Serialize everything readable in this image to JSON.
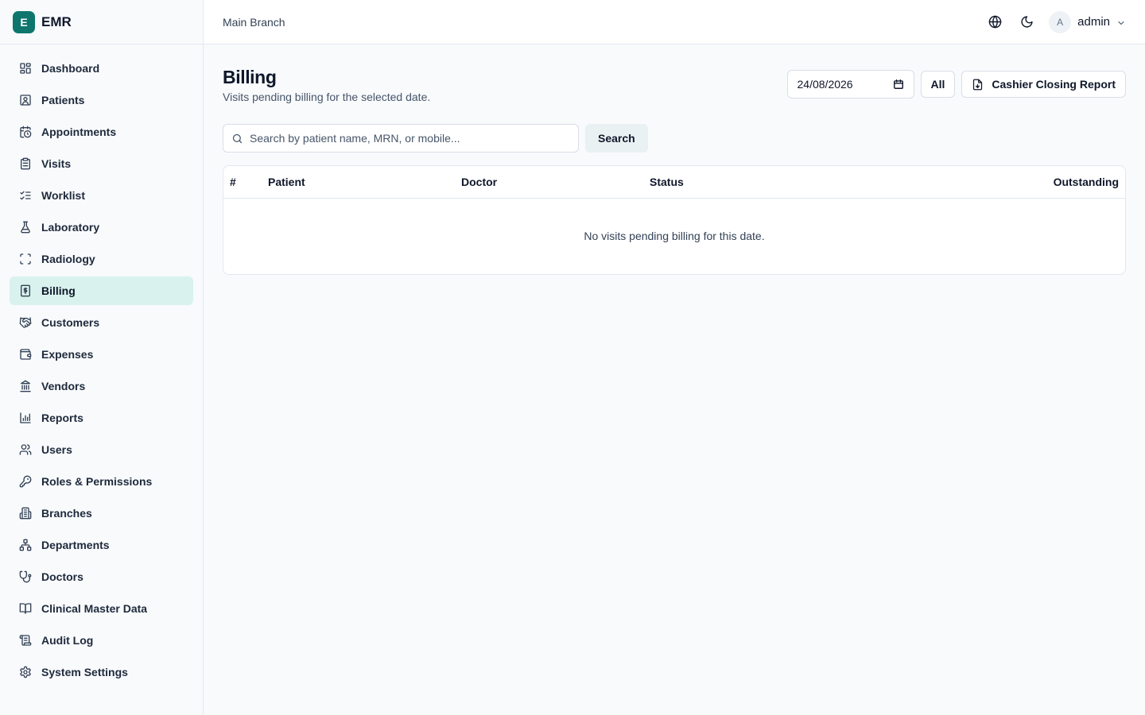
{
  "brand": {
    "logo_letter": "E",
    "name": "EMR"
  },
  "sidebar": {
    "items": [
      {
        "label": "Dashboard",
        "icon": "dashboard-icon",
        "active": false
      },
      {
        "label": "Patients",
        "icon": "patient-icon",
        "active": false
      },
      {
        "label": "Appointments",
        "icon": "calendar-clock-icon",
        "active": false
      },
      {
        "label": "Visits",
        "icon": "clipboard-icon",
        "active": false
      },
      {
        "label": "Worklist",
        "icon": "list-checks-icon",
        "active": false
      },
      {
        "label": "Laboratory",
        "icon": "flask-icon",
        "active": false
      },
      {
        "label": "Radiology",
        "icon": "scan-icon",
        "active": false
      },
      {
        "label": "Billing",
        "icon": "receipt-dollar-icon",
        "active": true
      },
      {
        "label": "Customers",
        "icon": "handshake-icon",
        "active": false
      },
      {
        "label": "Expenses",
        "icon": "wallet-icon",
        "active": false
      },
      {
        "label": "Vendors",
        "icon": "bank-icon",
        "active": false
      },
      {
        "label": "Reports",
        "icon": "bar-chart-icon",
        "active": false
      },
      {
        "label": "Users",
        "icon": "users-icon",
        "active": false
      },
      {
        "label": "Roles & Permissions",
        "icon": "key-icon",
        "active": false
      },
      {
        "label": "Branches",
        "icon": "building-icon",
        "active": false
      },
      {
        "label": "Departments",
        "icon": "network-icon",
        "active": false
      },
      {
        "label": "Doctors",
        "icon": "stethoscope-icon",
        "active": false
      },
      {
        "label": "Clinical Master Data",
        "icon": "book-icon",
        "active": false
      },
      {
        "label": "Audit Log",
        "icon": "scroll-icon",
        "active": false
      },
      {
        "label": "System Settings",
        "icon": "gear-icon",
        "active": false
      }
    ]
  },
  "header": {
    "branch": "Main Branch",
    "language_icon": "globe-icon",
    "theme_icon": "moon-icon",
    "user": {
      "avatar_letter": "A",
      "name": "admin"
    }
  },
  "page": {
    "title": "Billing",
    "subtitle": "Visits pending billing for the selected date.",
    "date_value": "24/08/2026",
    "all_label": "All",
    "report_label": "Cashier Closing Report"
  },
  "search": {
    "placeholder": "Search by patient name, MRN, or mobile...",
    "value": "",
    "button_label": "Search"
  },
  "table": {
    "columns": [
      "#",
      "Patient",
      "Doctor",
      "Status",
      "Outstanding"
    ],
    "rows": [],
    "empty_message": "No visits pending billing for this date."
  },
  "colors": {
    "accent": "#0f766e",
    "active_nav_bg": "#d9f2ed",
    "border": "#e2e8f0"
  }
}
